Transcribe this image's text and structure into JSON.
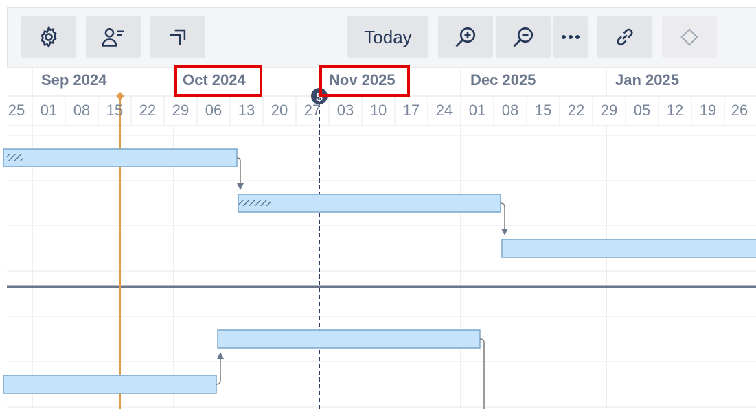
{
  "toolbar": {
    "settings_icon": "gear-icon",
    "people_icon": "user-list-icon",
    "collapse_icon": "collapse-arrows-icon",
    "today_label": "Today",
    "zoom_in_icon": "zoom-in-icon",
    "zoom_out_icon": "zoom-out-icon",
    "more_icon": "more-icon",
    "link_icon": "link-icon",
    "milestone_icon": "diamond-icon"
  },
  "timeline": {
    "months": [
      {
        "label": "Sep 2024",
        "highlighted": false
      },
      {
        "label": "Oct 2024",
        "highlighted": true
      },
      {
        "label": "Nov 2025",
        "highlighted": true
      },
      {
        "label": "Dec 2025",
        "highlighted": false
      },
      {
        "label": "Jan 2025",
        "highlighted": false
      }
    ],
    "days": [
      "25",
      "01",
      "08",
      "15",
      "22",
      "29",
      "06",
      "13",
      "20",
      "27",
      "03",
      "10",
      "17",
      "24",
      "01",
      "08",
      "15",
      "22",
      "29",
      "05",
      "12",
      "19",
      "26"
    ]
  },
  "markers": {
    "current_date_icon": "dollar-marker-icon",
    "milestone_marker_icon": "diamond-marker-icon"
  },
  "colors": {
    "bar_fill": "#c5e3fa",
    "bar_border": "#7aa7cc",
    "milestone_line": "#e09b4b",
    "today_line": "#2f3d63",
    "highlight": "#e30000",
    "separator": "#6b778c"
  }
}
